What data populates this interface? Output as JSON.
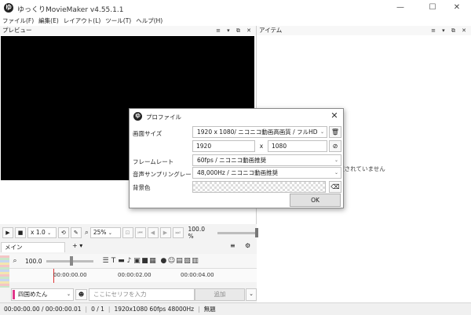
{
  "app": {
    "title": "ゆっくりMovieMaker v4.55.1.1",
    "logo_glyph": "ゆ",
    "window_controls": {
      "minimize": "—",
      "maximize": "☐",
      "close": "✕"
    }
  },
  "menu": [
    {
      "label": "ファイル(F)"
    },
    {
      "label": "編集(E)"
    },
    {
      "label": "レイアウト(L)"
    },
    {
      "label": "ツール(T)"
    },
    {
      "label": "ヘルプ(H)"
    }
  ],
  "preview": {
    "title": "プレビュー",
    "pane_controls": "≡ ▾ ⧉ ✕"
  },
  "items_pane": {
    "title": "アイテム",
    "pane_controls": "≡ ▾ ⧉ ✕",
    "empty_message": "アイテムが選択されていません"
  },
  "transport": {
    "speed": "x 1.0",
    "zoom": "25%",
    "zoom_percent": "100.0 %"
  },
  "timeline": {
    "tab_label": "メイン",
    "add_tab": "+ ▾",
    "zoom_value": "100.0",
    "ruler_labels": [
      "00:00:00.00",
      "00:00:02.00",
      "00:00:04.00"
    ]
  },
  "speech": {
    "speaker": "四国めたん",
    "placeholder": "ここにセリフを入力",
    "add_label": "追加"
  },
  "status": {
    "time": "00:00:00.00 / 00:00:00.01",
    "frame": "0 / 1",
    "format": "1920x1080 60fps 48000Hz",
    "title": "無題"
  },
  "dialog": {
    "title": "プロファイル",
    "close": "✕",
    "labels": {
      "screen_size": "画面サイズ",
      "frame_rate": "フレームレート",
      "sample_rate": "音声サンプリングレート",
      "background": "背景色"
    },
    "screen_size_preset": "1920 x 1080/ ニコニコ動画高画質 / フルHD",
    "width": "1920",
    "x_sep": "x",
    "height": "1080",
    "frame_rate": "60fps / ニコニコ動画推奨",
    "sample_rate": "48,000Hz / ニコニコ動画推奨",
    "ok": "OK"
  },
  "colors": {
    "accent_speaker": "#e0388a",
    "preview_canvas": "#000000"
  }
}
